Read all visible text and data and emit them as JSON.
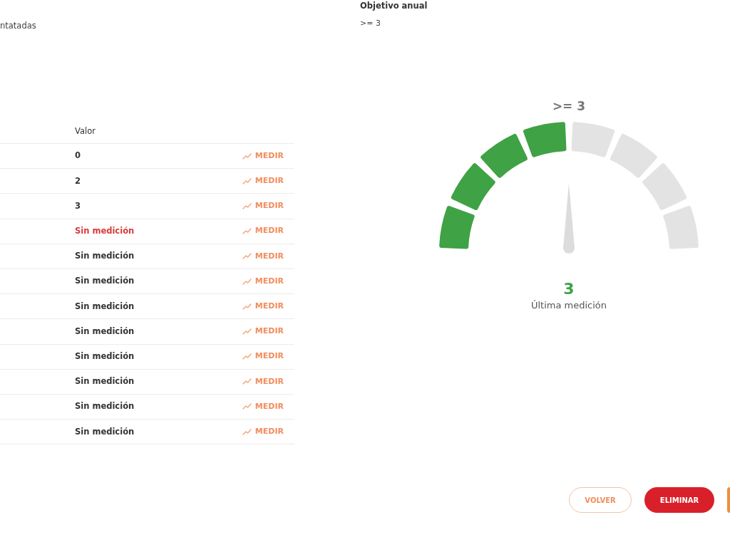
{
  "header": {
    "left_text": "ntatadas",
    "objective_label": "Objetivo anual",
    "objective_value": ">= 3"
  },
  "table": {
    "columns": [
      "Valor"
    ],
    "rows": [
      {
        "value": "0",
        "alert": false,
        "action": "MEDIR"
      },
      {
        "value": "2",
        "alert": false,
        "action": "MEDIR"
      },
      {
        "value": "3",
        "alert": false,
        "action": "MEDIR"
      },
      {
        "value": "Sin medición",
        "alert": true,
        "action": "MEDIR"
      },
      {
        "value": "Sin medición",
        "alert": false,
        "action": "MEDIR"
      },
      {
        "value": "Sin medición",
        "alert": false,
        "action": "MEDIR"
      },
      {
        "value": "Sin medición",
        "alert": false,
        "action": "MEDIR"
      },
      {
        "value": "Sin medición",
        "alert": false,
        "action": "MEDIR"
      },
      {
        "value": "Sin medición",
        "alert": false,
        "action": "MEDIR"
      },
      {
        "value": "Sin medición",
        "alert": false,
        "action": "MEDIR"
      },
      {
        "value": "Sin medición",
        "alert": false,
        "action": "MEDIR"
      },
      {
        "value": "Sin medición",
        "alert": false,
        "action": "MEDIR"
      }
    ]
  },
  "gauge": {
    "target": ">= 3",
    "level": 0.5,
    "value": "3",
    "caption": "Última medición"
  },
  "buttons": [
    {
      "label": "VOLVER",
      "kind": "outline"
    },
    {
      "label": "ELIMINAR",
      "kind": "danger"
    },
    {
      "kind": "partial"
    }
  ]
}
